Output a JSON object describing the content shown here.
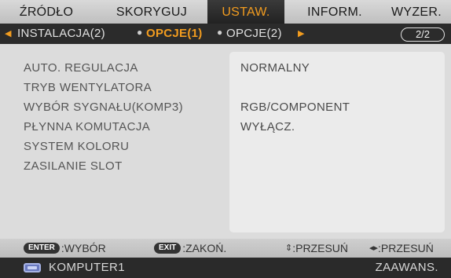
{
  "tabs": [
    {
      "label": "ŹRÓDŁO",
      "active": false
    },
    {
      "label": "SKORYGUJ",
      "active": false
    },
    {
      "label": "USTAW.",
      "active": true
    },
    {
      "label": "INFORM.",
      "active": false
    },
    {
      "label": "WYZER.",
      "active": false
    }
  ],
  "subtabs": [
    {
      "label": "INSTALACJA(2)",
      "active": false
    },
    {
      "label": "OPCJE(1)",
      "active": true
    },
    {
      "label": "OPCJE(2)",
      "active": false
    }
  ],
  "subtab_nav": {
    "left_arrow_icon": "triangle-left-icon",
    "right_arrow_icon": "triangle-right-icon",
    "separator": "●",
    "page": "2/2"
  },
  "options": [
    {
      "label": "AUTO. REGULACJA",
      "value": "NORMALNY"
    },
    {
      "label": "TRYB WENTYLATORA",
      "value": ""
    },
    {
      "label": "WYBÓR SYGNAŁU(KOMP3)",
      "value": "RGB/COMPONENT"
    },
    {
      "label": "PŁYNNA KOMUTACJA",
      "value": "WYŁĄCZ."
    },
    {
      "label": "SYSTEM KOLORU",
      "value": ""
    },
    {
      "label": "ZASILANIE SLOT",
      "value": ""
    }
  ],
  "footer": {
    "enter_key": "ENTER",
    "enter_action": ":WYBÓR",
    "exit_key": "EXIT",
    "exit_action": ":ZAKOŃ.",
    "updown_glyph": "⇕",
    "updown_action": ":PRZESUŃ",
    "leftright_glyph": "◂▸",
    "leftright_action": ":PRZESUŃ"
  },
  "status": {
    "source_icon": "monitor-icon",
    "source": "KOMPUTER1",
    "mode": "ZAAWANS."
  },
  "colors": {
    "accent": "#f29c1f",
    "tab_bar": "#cccccc",
    "subtab_bar": "#2b2b2b",
    "panel": "#dcdcdc",
    "value_box": "#ebebeb",
    "status_bar": "#2a2a2a"
  }
}
